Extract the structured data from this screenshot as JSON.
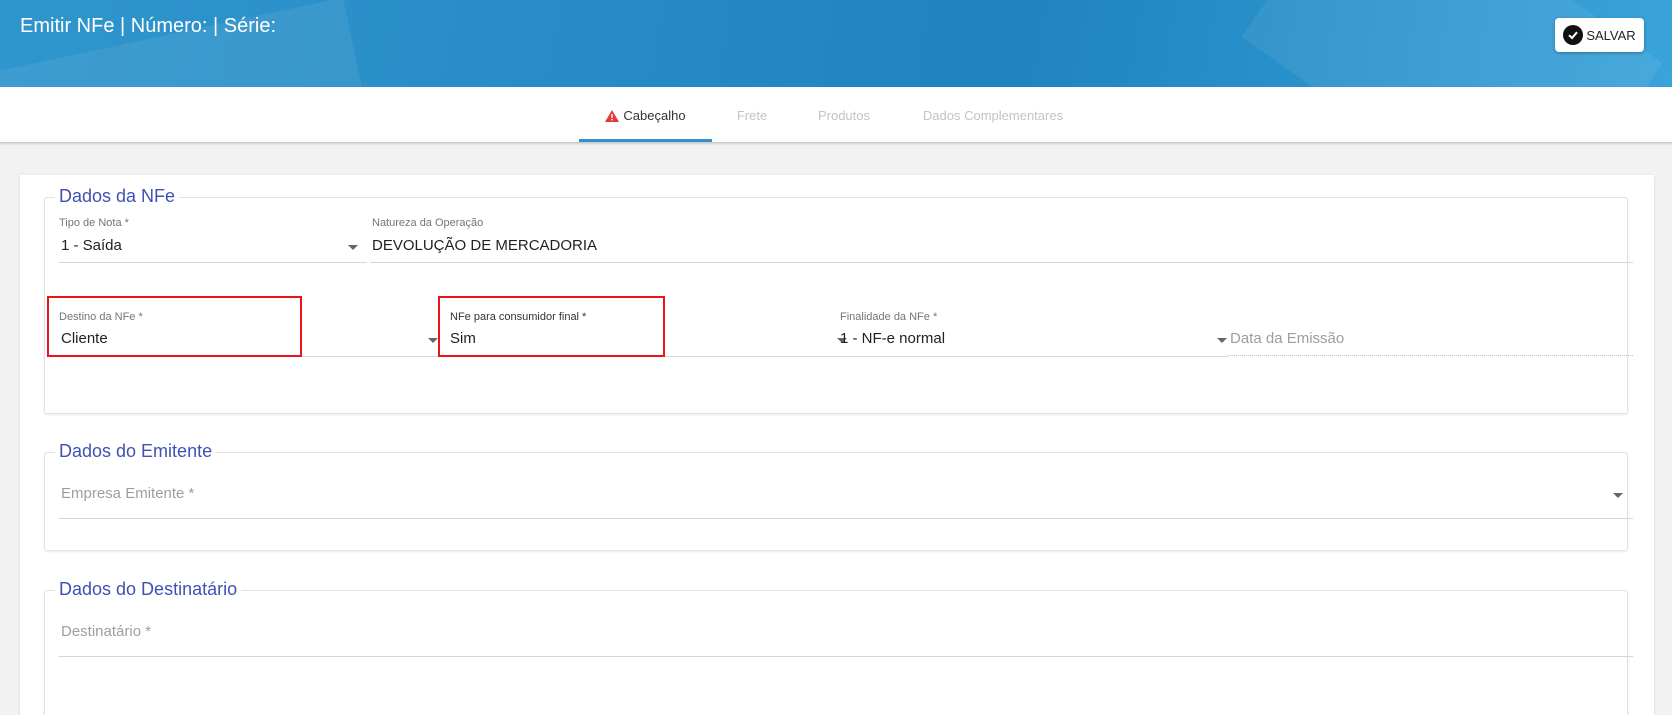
{
  "header": {
    "title": "Emitir NFe | Número: | Série:",
    "save_label": "SALVAR"
  },
  "tabs": [
    {
      "label": "Cabeçalho",
      "active": true,
      "warning": true
    },
    {
      "label": "Frete",
      "active": false
    },
    {
      "label": "Produtos",
      "active": false
    },
    {
      "label": "Dados Complementares",
      "active": false
    }
  ],
  "dados_nfe": {
    "legend": "Dados da NFe",
    "tipo_nota": {
      "label": "Tipo de Nota *",
      "value": "1 - Saída"
    },
    "natureza": {
      "label": "Natureza da Operação",
      "value": "DEVOLUÇÃO DE MERCADORIA"
    },
    "destino": {
      "label": "Destino da NFe *",
      "value": "Cliente"
    },
    "consumidor_final": {
      "label": "NFe para consumidor final *",
      "value": "Sim"
    },
    "finalidade": {
      "label": "Finalidade da NFe *",
      "value": "1 - NF-e normal"
    },
    "data_emissao": {
      "placeholder": "Data da Emissão"
    }
  },
  "dados_emitente": {
    "legend": "Dados do Emitente",
    "empresa": {
      "placeholder": "Empresa Emitente *"
    }
  },
  "dados_destinatario": {
    "legend": "Dados do Destinatário",
    "destinatario": {
      "placeholder": "Destinatário *"
    }
  },
  "colors": {
    "accent": "#3f51b5",
    "header": "#1f83bf",
    "highlight": "#e8161a",
    "warning": "#e53935"
  }
}
